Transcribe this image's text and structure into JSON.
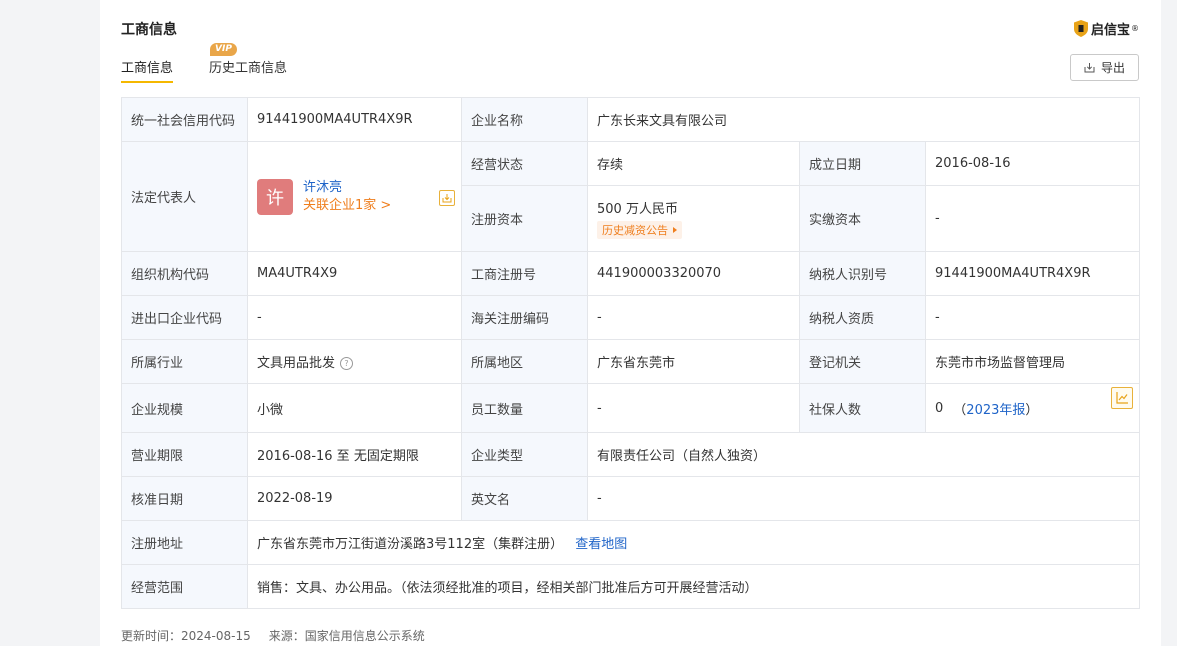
{
  "section": {
    "title": "工商信息"
  },
  "logo": {
    "text": "启信宝",
    "tm": "®"
  },
  "tabs": [
    {
      "label": "工商信息"
    },
    {
      "label": "历史工商信息",
      "badge": "VIP"
    }
  ],
  "export": {
    "label": "导出"
  },
  "info": {
    "credit_code_label": "统一社会信用代码",
    "credit_code": "91441900MA4UTR4X9R",
    "company_name_label": "企业名称",
    "company_name": "广东长来文具有限公司",
    "legal_rep_label": "法定代表人",
    "legal_rep_avatar": "许",
    "legal_rep_name": "许沐亮",
    "legal_rep_related": "关联企业1家 >",
    "status_label": "经营状态",
    "status": "存续",
    "founded_label": "成立日期",
    "founded": "2016-08-16",
    "reg_capital_label": "注册资本",
    "reg_capital": "500 万人民币",
    "reg_capital_tag": "历史减资公告",
    "paid_capital_label": "实缴资本",
    "paid_capital": "-",
    "org_code_label": "组织机构代码",
    "org_code": "MA4UTR4X9",
    "reg_no_label": "工商注册号",
    "reg_no": "441900003320070",
    "taxpayer_id_label": "纳税人识别号",
    "taxpayer_id": "91441900MA4UTR4X9R",
    "import_export_label": "进出口企业代码",
    "import_export": "-",
    "customs_label": "海关注册编码",
    "customs": "-",
    "taxpayer_qual_label": "纳税人资质",
    "taxpayer_qual": "-",
    "industry_label": "所属行业",
    "industry": "文具用品批发",
    "region_label": "所属地区",
    "region": "广东省东莞市",
    "authority_label": "登记机关",
    "authority": "东莞市市场监督管理局",
    "scale_label": "企业规模",
    "scale": "小微",
    "employees_label": "员工数量",
    "employees": "-",
    "social_label": "社保人数",
    "social_value": "0",
    "social_open": "（",
    "social_link": "2023年报",
    "social_close": "）",
    "term_label": "营业期限",
    "term": "2016-08-16 至 无固定期限",
    "type_label": "企业类型",
    "type": "有限责任公司（自然人独资）",
    "approval_label": "核准日期",
    "approval": "2022-08-19",
    "english_label": "英文名",
    "english": "-",
    "address_label": "注册地址",
    "address": "广东省东莞市万江街道汾溪路3号112室（集群注册）",
    "address_map": "查看地图",
    "scope_label": "经营范围",
    "scope": "销售：文具、办公用品。（依法须经批准的项目，经相关部门批准后方可开展经营活动）"
  },
  "footer": {
    "updated": "更新时间：2024-08-15",
    "source": "来源：国家信用信息公示系统"
  },
  "colors": {
    "accent": "#f5b800",
    "link": "#1f64c8",
    "orange": "#ef7e1d"
  }
}
